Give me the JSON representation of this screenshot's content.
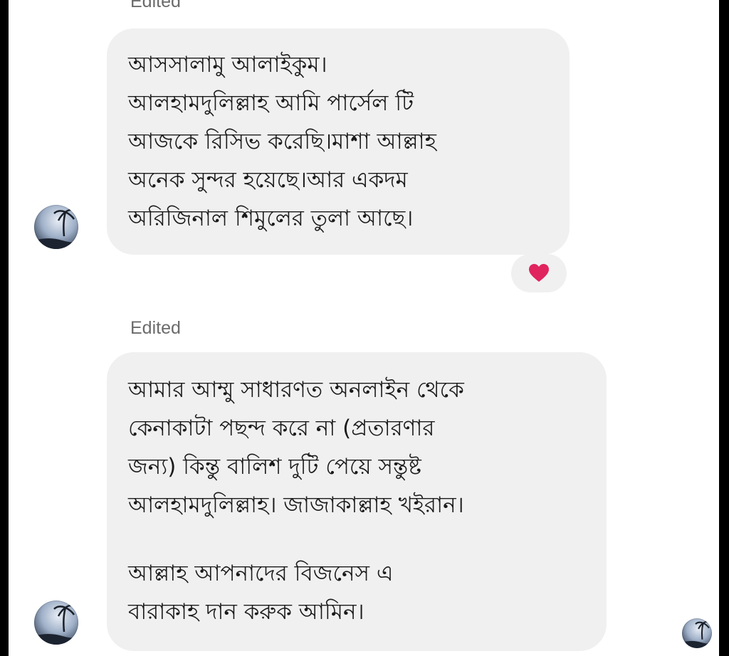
{
  "messages": [
    {
      "status": "Edited",
      "lines": [
        "আসসালামু আলাইকুম।",
        "আলহামদুলিল্লাহ আমি পার্সেল টি",
        "আজকে রিসিভ করেছি।মাশা আল্লাহ",
        "অনেক সুন্দর হয়েছে।আর একদম",
        "অরিজিনাল শিমুলের তুলা আছে।"
      ],
      "reaction": {
        "icon": "heart-icon",
        "color": "#e0245e"
      }
    },
    {
      "status": "Edited",
      "lines": [
        "আমার আম্মু সাধারণত অনলাইন থেকে",
        "কেনাকাটা পছন্দ করে না (প্রতারণার",
        "জন্য)  কিন্তু বালিশ দুটি পেয়ে সন্তুষ্ট",
        "আলহামদুলিল্লাহ। জাজাকাল্লাহ খইরান।"
      ],
      "lines_after_break": [
        "আল্লাহ আপনাদের বিজনেস এ",
        "বারাকাহ দান করুক আমিন।"
      ]
    }
  ],
  "colors": {
    "bubble": "#f0f0f0",
    "background": "#ffffff",
    "status_text": "#6b6b6b",
    "reaction": "#e0245e"
  }
}
